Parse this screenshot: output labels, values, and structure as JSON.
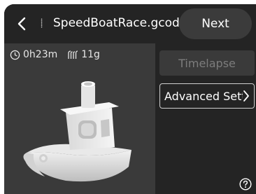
{
  "header": {
    "filename": "SpeedBoatRace.gcode",
    "file_glyph": "⸽",
    "next_label": "Next"
  },
  "preview": {
    "time": "0h23m",
    "weight": "11g"
  },
  "side": {
    "timelapse_label": "Timelapse",
    "advanced_label": "Advanced Settings"
  },
  "colors": {
    "background": "#242424",
    "button": "#3b3b3b",
    "preview_bg": "#3a3a3a",
    "disabled_text": "#7c7c7c"
  }
}
